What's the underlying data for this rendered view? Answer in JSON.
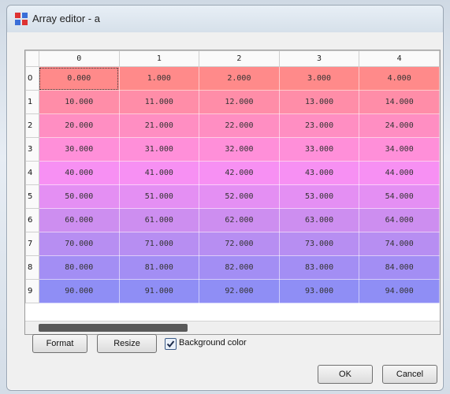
{
  "window": {
    "title": "Array editor - a"
  },
  "grid": {
    "columns": [
      "0",
      "1",
      "2",
      "3",
      "4"
    ],
    "rows": [
      {
        "index": "0",
        "values": [
          "0.000",
          "1.000",
          "2.000",
          "3.000",
          "4.000"
        ],
        "color": "#ff8a8a"
      },
      {
        "index": "1",
        "values": [
          "10.000",
          "11.000",
          "12.000",
          "13.000",
          "14.000"
        ],
        "color": "#ff8da8"
      },
      {
        "index": "2",
        "values": [
          "20.000",
          "21.000",
          "22.000",
          "23.000",
          "24.000"
        ],
        "color": "#ff8ec2"
      },
      {
        "index": "3",
        "values": [
          "30.000",
          "31.000",
          "32.000",
          "33.000",
          "34.000"
        ],
        "color": "#ff8fd9"
      },
      {
        "index": "4",
        "values": [
          "40.000",
          "41.000",
          "42.000",
          "43.000",
          "44.000"
        ],
        "color": "#f790f3"
      },
      {
        "index": "5",
        "values": [
          "50.000",
          "51.000",
          "52.000",
          "53.000",
          "54.000"
        ],
        "color": "#e48ff3"
      },
      {
        "index": "6",
        "values": [
          "60.000",
          "61.000",
          "62.000",
          "63.000",
          "64.000"
        ],
        "color": "#cd8ef0"
      },
      {
        "index": "7",
        "values": [
          "70.000",
          "71.000",
          "72.000",
          "73.000",
          "74.000"
        ],
        "color": "#b78ef2"
      },
      {
        "index": "8",
        "values": [
          "80.000",
          "81.000",
          "82.000",
          "83.000",
          "84.000"
        ],
        "color": "#a38ef4"
      },
      {
        "index": "9",
        "values": [
          "90.000",
          "91.000",
          "92.000",
          "93.000",
          "94.000"
        ],
        "color": "#8f8ef5"
      }
    ],
    "selected_cell": {
      "row": 0,
      "col": 0
    }
  },
  "buttons": {
    "format": "Format",
    "resize": "Resize",
    "ok": "OK",
    "cancel": "Cancel"
  },
  "options": {
    "background_color_label": "Background color",
    "background_color_checked": true
  },
  "icons": {
    "window": "array-editor-app-icon",
    "checkbox": "checkmark-icon"
  }
}
